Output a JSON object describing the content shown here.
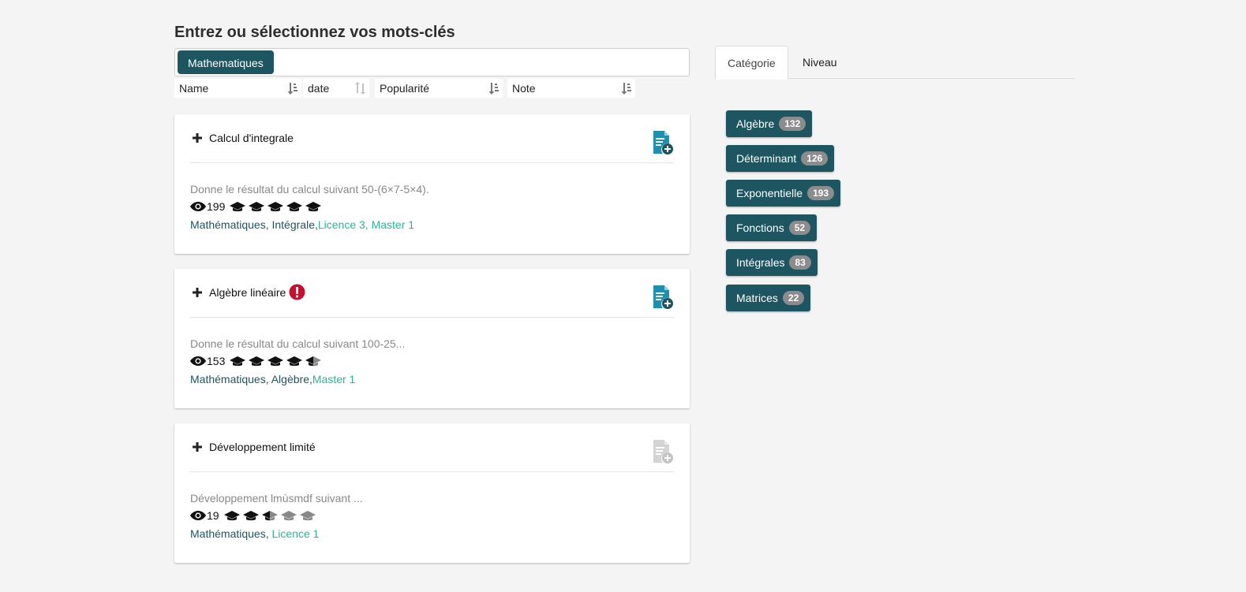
{
  "search": {
    "title": "Entrez ou sélectionnez vos mots-clés",
    "selected_tag": "Mathematiques"
  },
  "sort": {
    "name": "Name",
    "date": "date",
    "popularity": "Popularité",
    "note": "Note"
  },
  "cards": [
    {
      "title": "Calcul d'integrale",
      "description": "Donne le résultat du calcul suivant 50-(6×7-5×4).",
      "views": "199",
      "difficulty": 5,
      "categories": "Mathématiques, Intégrale,",
      "levels": "Licence 3, Master 1",
      "has_alert": false,
      "doc_icon_active": true
    },
    {
      "title": "Algèbre linéaire",
      "description": "Donne le résultat du calcul suivant 100-25...",
      "views": "153",
      "difficulty": 4.5,
      "categories": "Mathématiques, Algèbre,",
      "levels": "Master 1",
      "has_alert": true,
      "doc_icon_active": true
    },
    {
      "title": "Développement limité",
      "description": "Développement lmùsmdf suivant ...",
      "views": "19",
      "difficulty": 2.5,
      "categories": "Mathématiques, ",
      "levels": "Licence 1",
      "has_alert": false,
      "doc_icon_active": false
    }
  ],
  "tabs": {
    "category": "Catégorie",
    "level": "Niveau"
  },
  "category_filters": [
    {
      "label": "Algèbre",
      "count": "132"
    },
    {
      "label": "Déterminant",
      "count": "126"
    },
    {
      "label": "Exponentielle",
      "count": "193"
    },
    {
      "label": "Fonctions",
      "count": "52"
    },
    {
      "label": "Intégrales",
      "count": "83"
    },
    {
      "label": "Matrices",
      "count": "22"
    }
  ],
  "colors": {
    "primary": "#1d5560",
    "level_link": "#2ab596",
    "alert": "#c8102e",
    "doc_icon": "#1d8fb0"
  },
  "icons": {
    "add": "plus-icon",
    "views": "eye-icon",
    "difficulty": "graduation-cap-icon",
    "add_document": "document-add-icon",
    "alert": "exclamation-circle-icon",
    "sort": "sort-icon"
  }
}
